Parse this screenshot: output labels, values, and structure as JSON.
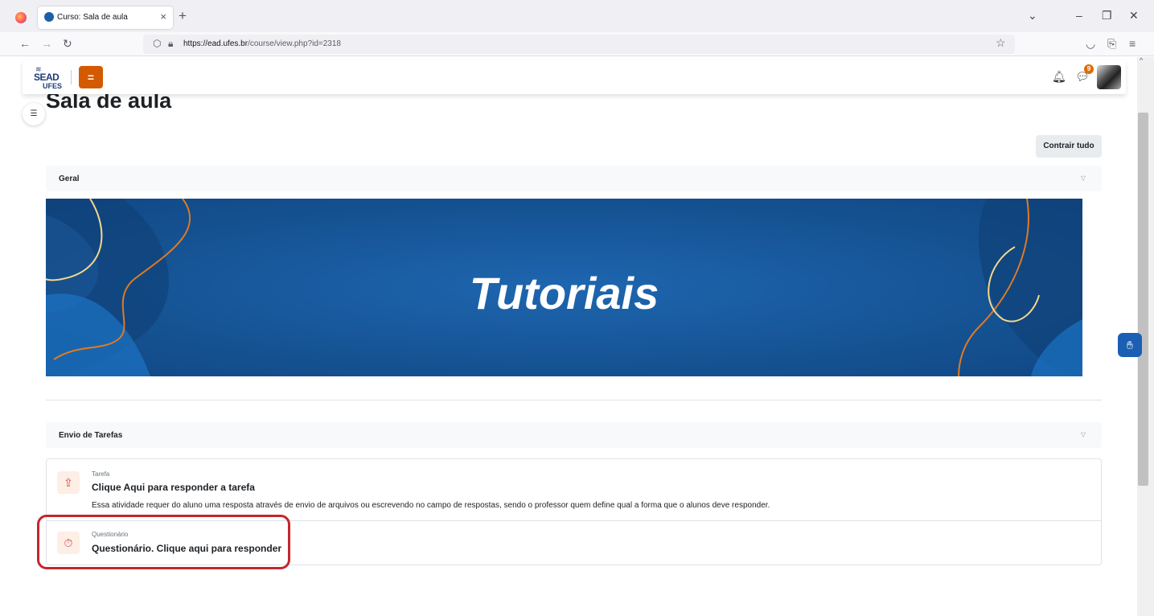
{
  "browser": {
    "tab_title": "Curso: Sala de aula",
    "tab_close": "×",
    "new_tab": "+",
    "url_host": "https://ead.ufes.br",
    "url_path": "/course/view.php?id=2318",
    "icons": [
      "firefox-logo",
      "back-arrow",
      "forward-arrow",
      "reload",
      "shield",
      "lock",
      "star",
      "pocket",
      "extensions",
      "hamburger-menu",
      "list-all-tabs",
      "minimize",
      "restore",
      "close"
    ]
  },
  "header": {
    "logo_top": "SEAD",
    "logo_bottom": "UFES",
    "menu_icon": "=",
    "notification_count": "9"
  },
  "page": {
    "title": "Sala de aula",
    "collapse_all": "Contrair tudo"
  },
  "sections": [
    {
      "title": "Geral"
    },
    {
      "title": "Envio de Tarefas"
    }
  ],
  "banner": {
    "text": "Tutoriais",
    "colors": {
      "background": "#14508f",
      "orange_line": "#e07a22",
      "yellow_line": "#f2d88a"
    }
  },
  "activities": [
    {
      "type": "Tarefa",
      "name": "Clique Aqui para responder a tarefa",
      "description": "Essa atividade requer  do aluno uma resposta através de envio de arquivos ou escrevendo no campo de respostas, sendo o professor quem define qual a forma que o alunos deve responder.",
      "icon": "assignment-upload-icon"
    },
    {
      "type": "Questionário",
      "name": "Questionário. Clique aqui para responder",
      "icon": "quiz-timer-icon"
    }
  ],
  "colors": {
    "accent": "#d35a00",
    "highlight_border": "#c4262e",
    "accessibility": "#1a5fb4"
  }
}
